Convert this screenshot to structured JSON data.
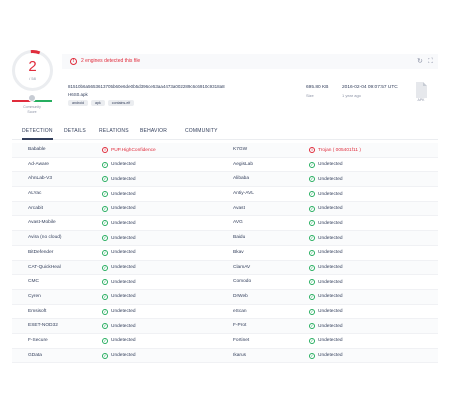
{
  "score": {
    "detected": "2",
    "total": "/ 58"
  },
  "community": {
    "label_line1": "Community",
    "label_line2": "Score"
  },
  "banner": {
    "message": "2 engines detected this file",
    "warn_icon": "exclamation-circle-icon",
    "actions": [
      "refresh-icon",
      "fullscreen-icon"
    ]
  },
  "file": {
    "hash": "81510b6a5653613705b60e6de0b5d396ce53aa4473a002289c6c6910c9318a8",
    "name": "H6S0.apk",
    "tags": [
      "android",
      "apk",
      "contains-elf"
    ],
    "size_value": "695.80 KB",
    "size_label": "Size",
    "date_value": "2016-02-04 09:07:57 UTC",
    "date_label": "1 year ago",
    "type_label": "APK"
  },
  "tabs": [
    "DETECTION",
    "DETAILS",
    "RELATIONS",
    "BEHAVIOR",
    "COMMUNITY"
  ],
  "colors": {
    "malicious": "#e02c3c",
    "clean": "#27ae60",
    "text": "#313d5a"
  },
  "detections": [
    [
      {
        "engine": "Babable",
        "result": "PUP.HighConfidence",
        "status": "bad"
      },
      {
        "engine": "K7GW",
        "result": "Trojan ( 005401f11 )",
        "status": "bad"
      }
    ],
    [
      {
        "engine": "Ad-Aware",
        "result": "Undetected",
        "status": "ok"
      },
      {
        "engine": "AegisLab",
        "result": "Undetected",
        "status": "ok"
      }
    ],
    [
      {
        "engine": "AhnLab-V3",
        "result": "Undetected",
        "status": "ok"
      },
      {
        "engine": "Alibaba",
        "result": "Undetected",
        "status": "ok"
      }
    ],
    [
      {
        "engine": "ALYac",
        "result": "Undetected",
        "status": "ok"
      },
      {
        "engine": "Antiy-AVL",
        "result": "Undetected",
        "status": "ok"
      }
    ],
    [
      {
        "engine": "Arcabit",
        "result": "Undetected",
        "status": "ok"
      },
      {
        "engine": "Avast",
        "result": "Undetected",
        "status": "ok"
      }
    ],
    [
      {
        "engine": "Avast-Mobile",
        "result": "Undetected",
        "status": "ok"
      },
      {
        "engine": "AVG",
        "result": "Undetected",
        "status": "ok"
      }
    ],
    [
      {
        "engine": "Avira (no cloud)",
        "result": "Undetected",
        "status": "ok"
      },
      {
        "engine": "Baidu",
        "result": "Undetected",
        "status": "ok"
      }
    ],
    [
      {
        "engine": "BitDefender",
        "result": "Undetected",
        "status": "ok"
      },
      {
        "engine": "Bkav",
        "result": "Undetected",
        "status": "ok"
      }
    ],
    [
      {
        "engine": "CAT-QuickHeal",
        "result": "Undetected",
        "status": "ok"
      },
      {
        "engine": "ClamAV",
        "result": "Undetected",
        "status": "ok"
      }
    ],
    [
      {
        "engine": "CMC",
        "result": "Undetected",
        "status": "ok"
      },
      {
        "engine": "Comodo",
        "result": "Undetected",
        "status": "ok"
      }
    ],
    [
      {
        "engine": "Cyren",
        "result": "Undetected",
        "status": "ok"
      },
      {
        "engine": "DrWeb",
        "result": "Undetected",
        "status": "ok"
      }
    ],
    [
      {
        "engine": "Emsisoft",
        "result": "Undetected",
        "status": "ok"
      },
      {
        "engine": "eScan",
        "result": "Undetected",
        "status": "ok"
      }
    ],
    [
      {
        "engine": "ESET-NOD32",
        "result": "Undetected",
        "status": "ok"
      },
      {
        "engine": "F-Prot",
        "result": "Undetected",
        "status": "ok"
      }
    ],
    [
      {
        "engine": "F-Secure",
        "result": "Undetected",
        "status": "ok"
      },
      {
        "engine": "Fortinet",
        "result": "Undetected",
        "status": "ok"
      }
    ],
    [
      {
        "engine": "GData",
        "result": "Undetected",
        "status": "ok"
      },
      {
        "engine": "Ikarus",
        "result": "Undetected",
        "status": "ok"
      }
    ]
  ]
}
